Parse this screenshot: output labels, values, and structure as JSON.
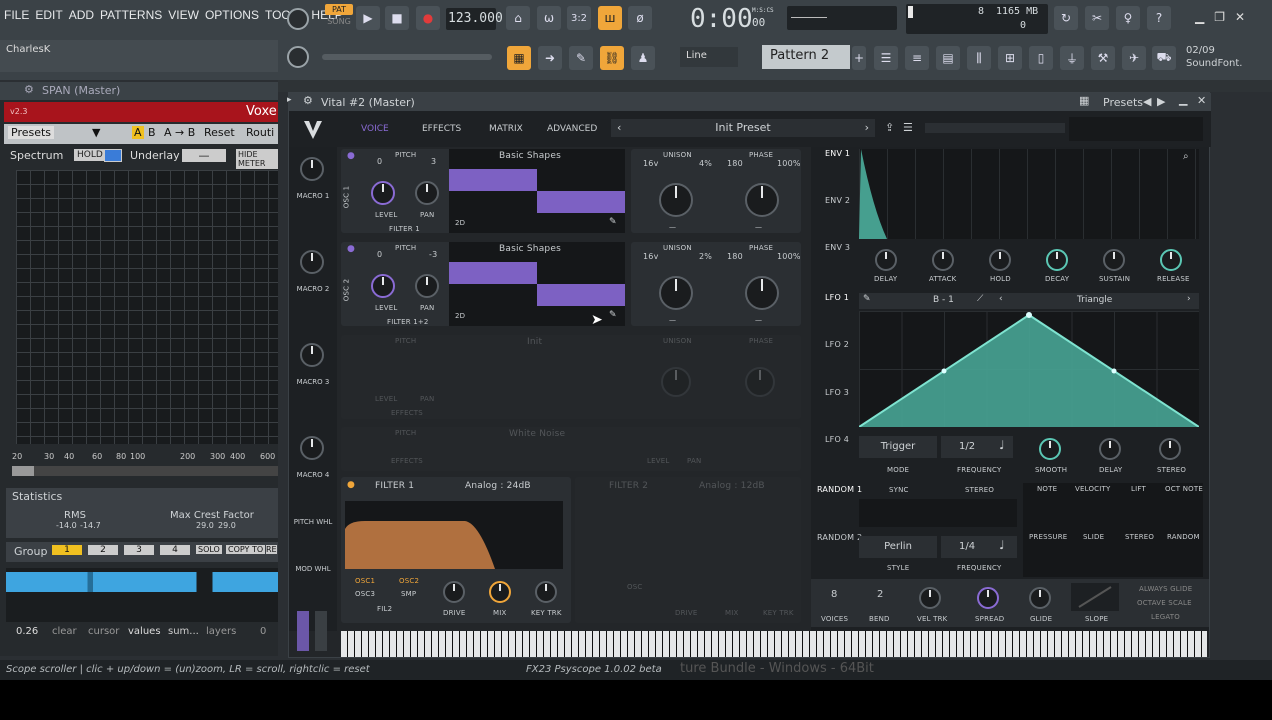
{
  "menu": [
    "FILE",
    "EDIT",
    "ADD",
    "PATTERNS",
    "VIEW",
    "OPTIONS",
    "TOOLS",
    "HELP"
  ],
  "transport": {
    "pat": "PAT",
    "song": "SONG",
    "tempo": "123.000",
    "time": "0:00",
    "time_sub": "00",
    "time_unit": "M:S:CS"
  },
  "monitor": {
    "cpu_val": "8",
    "mem": "1165 MB",
    "poly": "0"
  },
  "user": "CharlesK",
  "pattern": {
    "name": "Pattern 2",
    "snap": "Line"
  },
  "news": {
    "date": "02/09",
    "text": "SoundFont."
  },
  "span": {
    "title": "SPAN (Master)",
    "version": "v2.3",
    "vendor": "Voxe",
    "presets": "Presets",
    "a": "A",
    "b": "B",
    "ab": "A → B",
    "reset": "Reset",
    "routing": "Routi",
    "spectrum": "Spectrum",
    "hold": "HOLD",
    "underlay": "Underlay",
    "underlay_val": "—",
    "hide_meter": "HIDE METER",
    "freqs": [
      "20",
      "30",
      "40",
      "60",
      "80",
      "100",
      "200",
      "300",
      "400",
      "600"
    ]
  },
  "stats": {
    "title": "Statistics",
    "rms_label": "RMS",
    "rms_l": "-14.0",
    "rms_r": "-14.7",
    "mcf_label": "Max Crest Factor",
    "mcf_l": "29.0",
    "mcf_r": "29.0",
    "group": "Group",
    "groups": [
      "1",
      "2",
      "3",
      "4"
    ],
    "solo": "SOLO",
    "copy": "COPY TO",
    "re": "RE"
  },
  "scope": {
    "val": "0.26",
    "opts": [
      "clear",
      "cursor",
      "values",
      "sum...",
      "layers"
    ],
    "zero": "0"
  },
  "status": {
    "left": "Scope scroller | clic + up/down = (un)zoom, LR = scroll, rightclic = reset",
    "mid": "FX23 Psyscope 1.0.02 beta",
    "right": "ture Bundle - Windows - 64Bit"
  },
  "vital": {
    "title": "Vital #2 (Master)",
    "presets": "Presets",
    "tabs": [
      "VOICE",
      "EFFECTS",
      "MATRIX",
      "ADVANCED"
    ],
    "preset_name": "Init Preset",
    "macros": [
      "MACRO 1",
      "MACRO 2",
      "MACRO 3",
      "MACRO 4"
    ],
    "pitch_wheel": "PITCH WHL",
    "mod_wheel": "MOD WHL",
    "osc1": {
      "label": "OSC 1",
      "pitch": "PITCH",
      "p1": "0",
      "p2": "3",
      "wave": "Basic Shapes",
      "dim": "2D",
      "level": "LEVEL",
      "pan": "PAN",
      "filter": "FILTER 1",
      "unison": "UNISON",
      "voices": "16v",
      "detune": "4%",
      "phase": "PHASE",
      "ph": "180",
      "ph_pct": "100%",
      "dash1": "—",
      "dash2": "—"
    },
    "osc2": {
      "label": "OSC 2",
      "pitch": "PITCH",
      "p1": "0",
      "p2": "-3",
      "wave": "Basic Shapes",
      "dim": "2D",
      "level": "LEVEL",
      "pan": "PAN",
      "filter": "FILTER 1+2",
      "unison": "UNISON",
      "voices": "16v",
      "detune": "2%",
      "phase": "PHASE",
      "ph": "180",
      "ph_pct": "100%",
      "dash1": "—",
      "dash2": "—"
    },
    "osc3": {
      "pitch": "PITCH",
      "wave": "Init",
      "level": "LEVEL",
      "pan": "PAN",
      "filter": "EFFECTS",
      "unison": "UNISON",
      "phase": "PHASE"
    },
    "smp": {
      "pitch": "PITCH",
      "wave": "White Noise",
      "level": "LEVEL",
      "pan": "PAN",
      "filter": "EFFECTS"
    },
    "filter1": {
      "label": "FILTER 1",
      "type": "Analog : 24dB",
      "osc1": "OSC1",
      "osc2": "OSC2",
      "osc3": "OSC3",
      "smp": "SMP",
      "fil2": "FIL2",
      "drive": "DRIVE",
      "mix": "MIX",
      "keytrk": "KEY TRK"
    },
    "filter2": {
      "label": "FILTER 2",
      "type": "Analog : 12dB",
      "osc": "OSC",
      "drive": "DRIVE",
      "mix": "MIX",
      "keytrk": "KEY TRK"
    },
    "env": {
      "names": [
        "ENV 1",
        "ENV 2",
        "ENV 3"
      ],
      "knobs": [
        "DELAY",
        "ATTACK",
        "HOLD",
        "DECAY",
        "SUSTAIN",
        "RELEASE"
      ]
    },
    "lfo": {
      "names": [
        "LFO 1",
        "LFO 2",
        "LFO 3",
        "LFO 4"
      ],
      "grid": "B - 1",
      "shape": "Triangle",
      "mode": "Trigger",
      "mode_label": "MODE",
      "freq": "1/2",
      "freq_label": "FREQUENCY",
      "knobs": [
        "SMOOTH",
        "DELAY",
        "STEREO"
      ]
    },
    "random": {
      "names": [
        "RANDOM 1",
        "RANDOM 2"
      ],
      "sync": "SYNC",
      "stereo": "STEREO",
      "style": "Perlin",
      "style_label": "STYLE",
      "freq": "1/4",
      "freq_label": "FREQUENCY"
    },
    "mods": [
      "NOTE",
      "VELOCITY",
      "LIFT",
      "OCT NOTE",
      "PRESSURE",
      "SLIDE",
      "STEREO",
      "RANDOM"
    ],
    "voice": {
      "voices": "8",
      "voices_label": "VOICES",
      "bend": "2",
      "bend_label": "BEND",
      "veltrk": "VEL TRK",
      "spread": "SPREAD",
      "glide": "GLIDE",
      "slope": "SLOPE",
      "always": "ALWAYS GLIDE",
      "octave": "OCTAVE SCALE",
      "legato": "LEGATO"
    }
  }
}
